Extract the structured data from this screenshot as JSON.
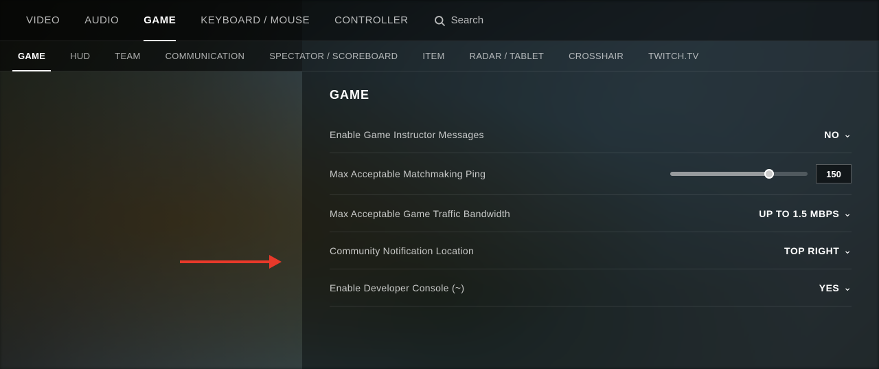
{
  "background": {},
  "mainNav": {
    "items": [
      {
        "id": "video",
        "label": "Video",
        "active": false
      },
      {
        "id": "audio",
        "label": "Audio",
        "active": false
      },
      {
        "id": "game",
        "label": "Game",
        "active": true
      },
      {
        "id": "keyboard-mouse",
        "label": "Keyboard / Mouse",
        "active": false
      },
      {
        "id": "controller",
        "label": "Controller",
        "active": false
      }
    ],
    "search": {
      "label": "Search",
      "placeholder": "Search"
    }
  },
  "subNav": {
    "items": [
      {
        "id": "game",
        "label": "Game",
        "active": true
      },
      {
        "id": "hud",
        "label": "Hud",
        "active": false
      },
      {
        "id": "team",
        "label": "Team",
        "active": false
      },
      {
        "id": "communication",
        "label": "Communication",
        "active": false
      },
      {
        "id": "spectator-scoreboard",
        "label": "Spectator / Scoreboard",
        "active": false
      },
      {
        "id": "item",
        "label": "Item",
        "active": false
      },
      {
        "id": "radar-tablet",
        "label": "Radar / Tablet",
        "active": false
      },
      {
        "id": "crosshair",
        "label": "Crosshair",
        "active": false
      },
      {
        "id": "twitchtv",
        "label": "Twitch.tv",
        "active": false
      }
    ]
  },
  "content": {
    "sectionTitle": "Game",
    "settings": [
      {
        "id": "enable-game-instructor",
        "label": "Enable Game Instructor Messages",
        "type": "dropdown",
        "value": "NO"
      },
      {
        "id": "max-matchmaking-ping",
        "label": "Max Acceptable Matchmaking Ping",
        "type": "slider",
        "value": "150",
        "sliderPercent": 72
      },
      {
        "id": "max-traffic-bandwidth",
        "label": "Max Acceptable Game Traffic Bandwidth",
        "type": "dropdown",
        "value": "UP TO 1.5 MBPS"
      },
      {
        "id": "community-notification",
        "label": "Community Notification Location",
        "type": "dropdown",
        "value": "TOP RIGHT"
      },
      {
        "id": "developer-console",
        "label": "Enable Developer Console (~)",
        "type": "dropdown",
        "value": "YES",
        "highlighted": true
      }
    ]
  }
}
